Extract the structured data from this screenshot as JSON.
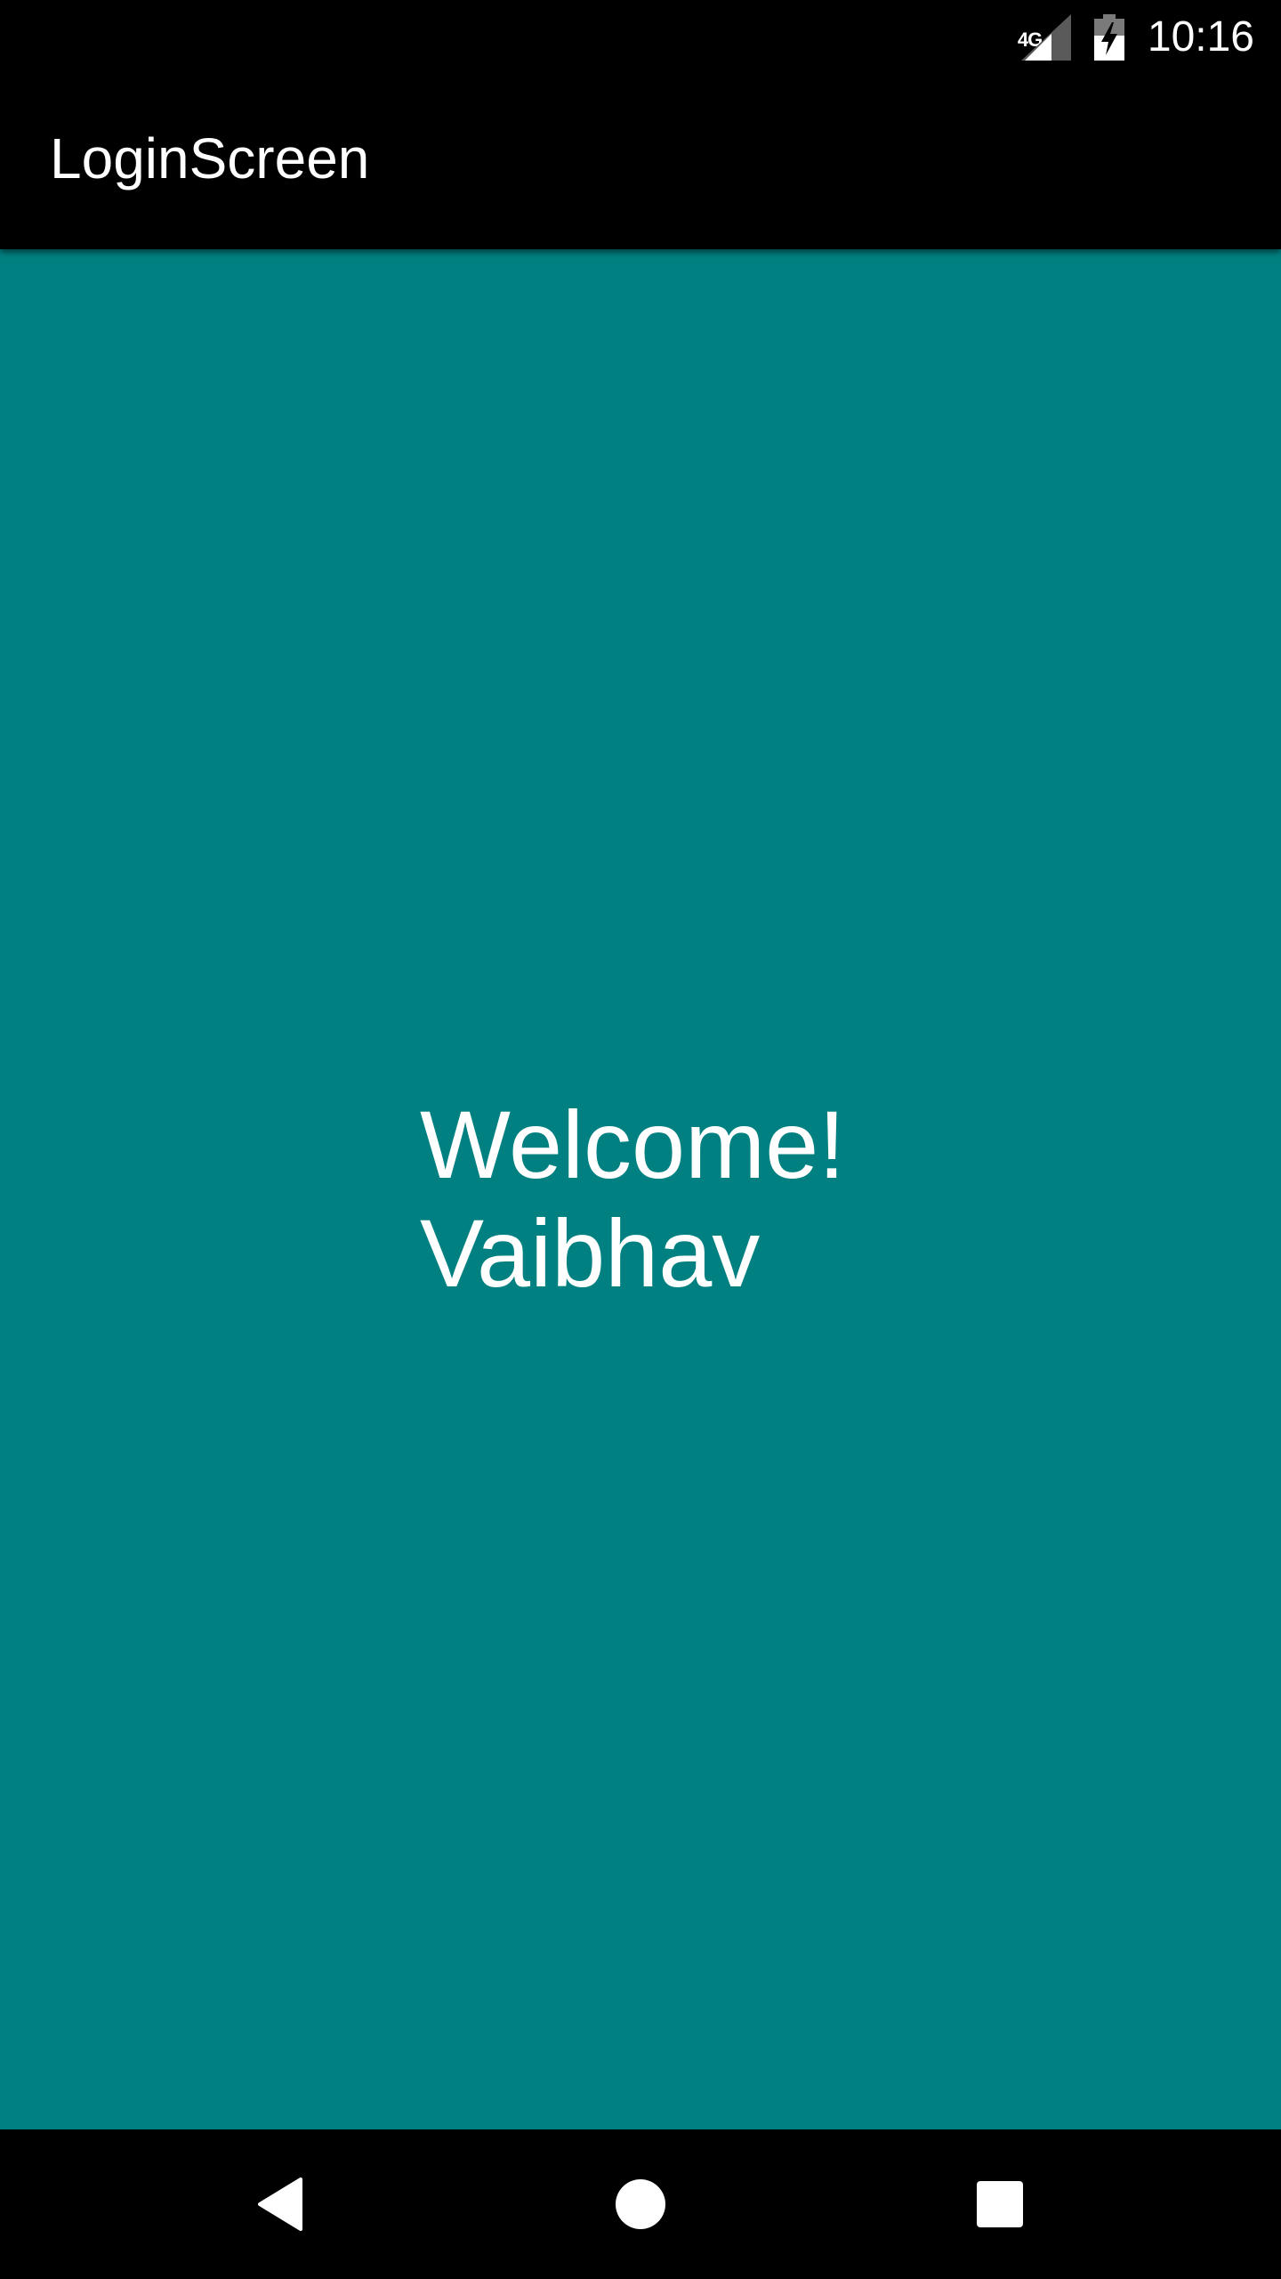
{
  "status_bar": {
    "network_type": "4G",
    "time": "10:16",
    "icons": {
      "signal": "cell-signal-icon",
      "battery": "battery-charging-icon"
    }
  },
  "app_bar": {
    "title": "LoginScreen"
  },
  "main": {
    "background_color": "#008080",
    "welcome_text": "Welcome!",
    "user_name": "Vaibhav"
  },
  "nav_bar": {
    "icons": {
      "back": "back-triangle-icon",
      "home": "home-circle-icon",
      "recents": "recents-square-icon"
    }
  },
  "colors": {
    "status_bar": "#000000",
    "app_bar": "#000000",
    "content": "#008080",
    "text": "#ffffff",
    "nav_bar": "#000000"
  }
}
